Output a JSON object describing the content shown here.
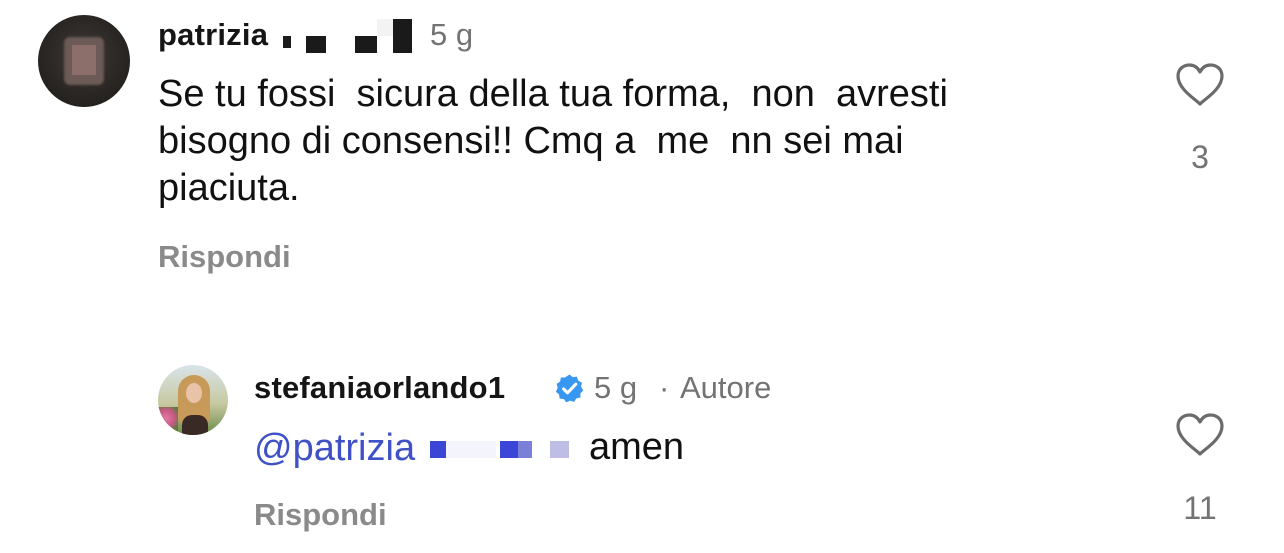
{
  "comment1": {
    "username": "patrizia",
    "time": "5 g",
    "lines": [
      "Se tu fossi  sicura della tua forma,  non  avresti",
      "bisogno di consensi!! Cmq a  me  nn sei mai",
      "piaciuta."
    ],
    "reply_label": "Rispondi",
    "like_count": "3"
  },
  "comment2": {
    "username": "stefaniaorlando1",
    "time": "5 g",
    "separator": "·",
    "author_label": "Autore",
    "mention": "@patrizia",
    "text": "amen",
    "reply_label": "Rispondi",
    "like_count": "11"
  },
  "colors": {
    "mention": "#3f51c6",
    "verified": "#3897f0",
    "muted": "#737373"
  }
}
